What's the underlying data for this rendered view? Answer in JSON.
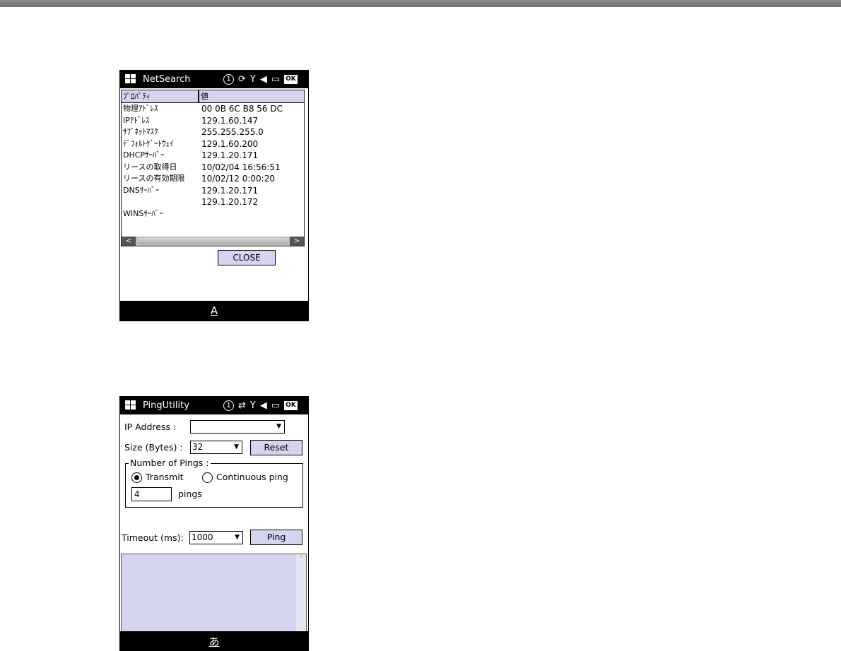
{
  "netsearch": {
    "title": "NetSearch",
    "status_icons": [
      "circled-one-icon",
      "sync-icon",
      "signal-icon",
      "volume-icon",
      "battery-icon",
      "ok-icon"
    ],
    "status_circle": "1",
    "status_ok": "OK",
    "columns": [
      "ﾌﾟﾛﾊﾟﾃｨ",
      "値"
    ],
    "rows": [
      {
        "property": "物理ｱﾄﾞﾚｽ",
        "value": "00 0B 6C B8 56 DC"
      },
      {
        "property": "IPｱﾄﾞﾚｽ",
        "value": "129.1.60.147"
      },
      {
        "property": "ｻﾌﾞﾈｯﾄﾏｽｸ",
        "value": "255.255.255.0"
      },
      {
        "property": "ﾃﾞﾌｫﾙﾄｹﾞｰﾄｳｪｲ",
        "value": "129.1.60.200"
      },
      {
        "property": "DHCPｻｰﾊﾞｰ",
        "value": "129.1.20.171"
      },
      {
        "property": "リースの取得日",
        "value": "10/02/04 16:56:51"
      },
      {
        "property": "リースの有効期限",
        "value": "10/02/12 0:00:20"
      },
      {
        "property": "DNSｻｰﾊﾞｰ",
        "value": "129.1.20.171"
      },
      {
        "property": "",
        "value": "129.1.20.172"
      },
      {
        "property": "WINSｻｰﾊﾞｰ",
        "value": ""
      }
    ],
    "close_label": "CLOSE",
    "ime_label": "A"
  },
  "pingutility": {
    "title": "PingUtility",
    "status_icons": [
      "circled-one-icon",
      "data-transfer-icon",
      "signal-icon",
      "volume-icon",
      "battery-icon",
      "ok-icon"
    ],
    "status_circle": "1",
    "status_ok": "OK",
    "ip_label": "IP Address :",
    "ip_value": "",
    "size_label": "Size (Bytes) :",
    "size_value": "32",
    "reset_label": "Reset",
    "group_title": "Number of Pings :",
    "transmit_label": "Transmit",
    "continuous_label": "Continuous ping",
    "selected_mode": "Transmit",
    "pings_value": "4",
    "pings_label": "pings",
    "timeout_label": "Timeout (ms):",
    "timeout_value": "1000",
    "ping_label": "Ping",
    "output_text": "",
    "ime_label": "あ"
  }
}
